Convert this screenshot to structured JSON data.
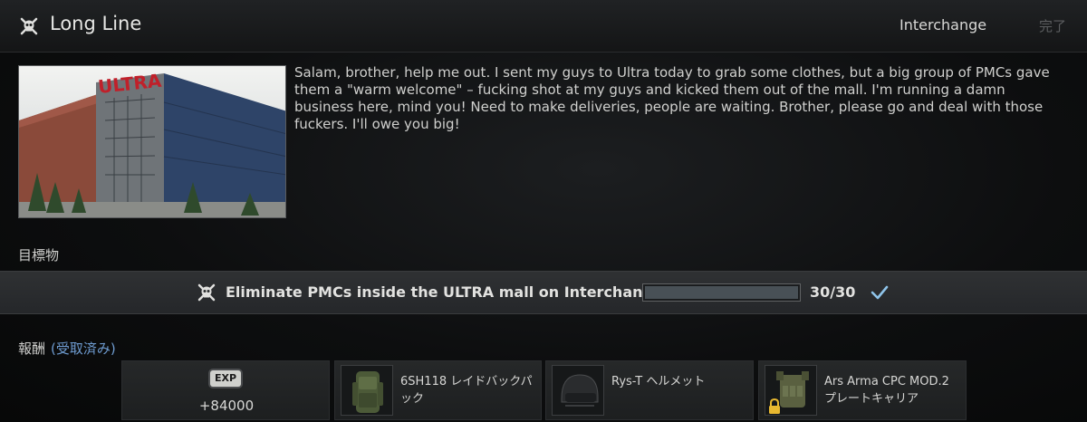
{
  "header": {
    "quest_title": "Long Line",
    "location": "Interchange",
    "complete_label": "完了"
  },
  "briefing": {
    "image_sign_text": "ULTRA",
    "text": "Salam, brother, help me out. I sent my guys to Ultra today to grab some clothes, but a big group of PMCs gave them a \"warm welcome\" – fucking shot at my guys and kicked them out of the mall. I'm running a damn business here, mind you! Need to make deliveries, people are waiting. Brother, please go and deal with those fuckers. I'll owe you big!"
  },
  "objectives": {
    "label": "目標物",
    "items": [
      {
        "text": "Eliminate PMCs inside the ULTRA mall on Interchange",
        "progress_current": 30,
        "progress_total": 30,
        "progress_text": "30/30",
        "progress_fraction": 1.0,
        "completed": true
      }
    ]
  },
  "rewards": {
    "label": "報酬",
    "status": "(受取済み)",
    "exp": {
      "badge": "EXP",
      "value": "+84000"
    },
    "items": [
      {
        "name": "6SH118 レイドバックパック",
        "icon": "backpack-icon"
      },
      {
        "name": "Rys-T ヘルメット",
        "icon": "helmet-icon"
      },
      {
        "name": "Ars Arma CPC MOD.2 プレートキャリア",
        "icon": "plate-carrier-icon",
        "locked": true
      }
    ]
  },
  "colors": {
    "accent_blue": "#6e9bd0",
    "check": "#8fc4ea",
    "progress_fill": "#485056"
  }
}
